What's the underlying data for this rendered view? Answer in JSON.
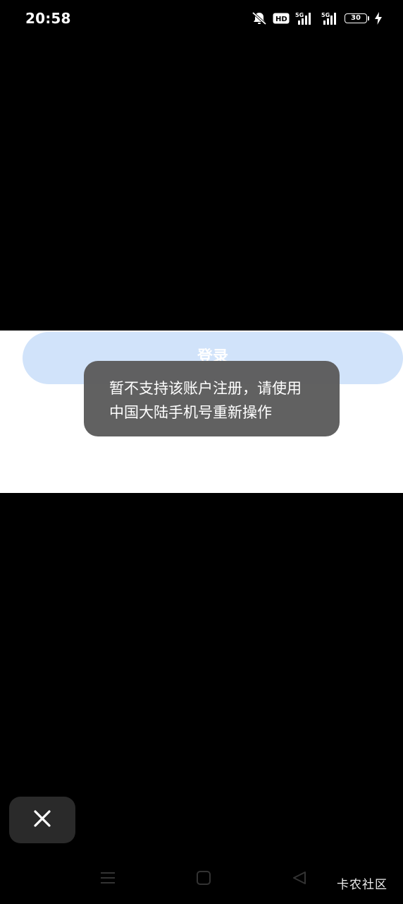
{
  "status_bar": {
    "time": "20:58",
    "hd_label": "HD",
    "network_1": "5G",
    "network_2": "5G",
    "battery_level": "30",
    "icons": [
      "mute-bell-icon",
      "hd-voice-icon",
      "signal-5g-icon",
      "signal-5g-icon",
      "battery-icon",
      "charging-icon"
    ]
  },
  "main": {
    "login_button_label": "登录"
  },
  "toast": {
    "message": "暂不支持该账户注册，请使用中国大陆手机号重新操作"
  },
  "floating": {
    "close_icon": "close-icon"
  },
  "nav": {
    "icons": [
      "menu-icon",
      "home-icon",
      "back-icon"
    ]
  },
  "watermark": {
    "text": "卡农社区"
  },
  "colors": {
    "background": "#000000",
    "panel": "#ffffff",
    "login_button": "#d1e3fa",
    "toast": "#5c5c5c",
    "close_button": "#2a2a2a"
  }
}
